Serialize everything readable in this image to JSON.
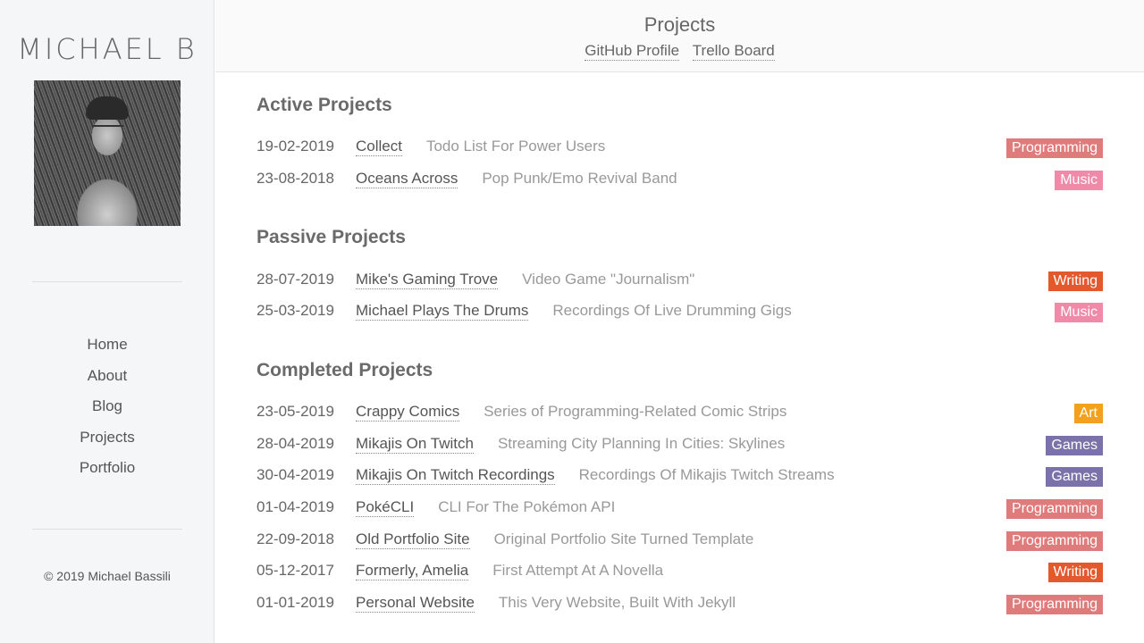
{
  "sidebar": {
    "logo": "MICHAEL B",
    "nav": [
      "Home",
      "About",
      "Blog",
      "Projects",
      "Portfolio"
    ],
    "copyright": "© 2019 Michael Bassili"
  },
  "header": {
    "title": "Projects",
    "links": [
      "GitHub Profile",
      "Trello Board"
    ]
  },
  "tag_colors": {
    "Programming": "#e07b7b",
    "Music": "#f08aa8",
    "Writing": "#e4582e",
    "Art": "#f3a11c",
    "Games": "#7a72a8"
  },
  "sections": [
    {
      "title": "Active Projects",
      "items": [
        {
          "date": "19-02-2019",
          "name": "Collect",
          "desc": "Todo List For Power Users",
          "tag": "Programming"
        },
        {
          "date": "23-08-2018",
          "name": "Oceans Across",
          "desc": "Pop Punk/Emo Revival Band",
          "tag": "Music"
        }
      ]
    },
    {
      "title": "Passive Projects",
      "items": [
        {
          "date": "28-07-2019",
          "name": "Mike's Gaming Trove",
          "desc": "Video Game \"Journalism\"",
          "tag": "Writing"
        },
        {
          "date": "25-03-2019",
          "name": "Michael Plays The Drums",
          "desc": "Recordings Of Live Drumming Gigs",
          "tag": "Music"
        }
      ]
    },
    {
      "title": "Completed Projects",
      "items": [
        {
          "date": "23-05-2019",
          "name": "Crappy Comics",
          "desc": "Series of Programming-Related Comic Strips",
          "tag": "Art"
        },
        {
          "date": "28-04-2019",
          "name": "Mikajis On Twitch",
          "desc": "Streaming City Planning In Cities: Skylines",
          "tag": "Games"
        },
        {
          "date": "30-04-2019",
          "name": "Mikajis On Twitch Recordings",
          "desc": "Recordings Of Mikajis Twitch Streams",
          "tag": "Games"
        },
        {
          "date": "01-04-2019",
          "name": "PokéCLI",
          "desc": "CLI For The Pokémon API",
          "tag": "Programming"
        },
        {
          "date": "22-09-2018",
          "name": "Old Portfolio Site",
          "desc": "Original Portfolio Site Turned Template",
          "tag": "Programming"
        },
        {
          "date": "05-12-2017",
          "name": "Formerly, Amelia",
          "desc": "First Attempt At A Novella",
          "tag": "Writing"
        },
        {
          "date": "01-01-2019",
          "name": "Personal Website",
          "desc": "This Very Website, Built With Jekyll",
          "tag": "Programming"
        }
      ]
    }
  ]
}
